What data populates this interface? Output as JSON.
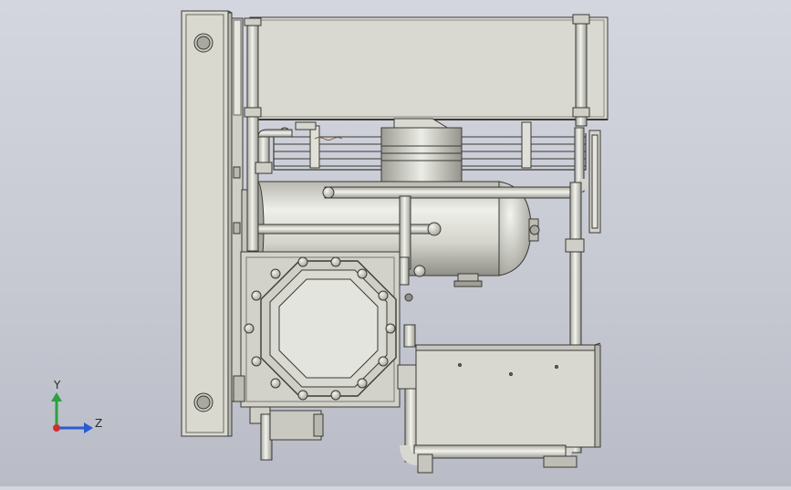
{
  "viewport": {
    "background_top": "#d4d6df",
    "background_bottom": "#b9bcc6",
    "part_color": "#d8d8cf",
    "edge_color": "#3a3a36"
  },
  "triad": {
    "y_label": "Y",
    "z_label": "Z",
    "y_color": "#2ea043",
    "z_color": "#2a5bd7",
    "x_color": "#d03030"
  }
}
